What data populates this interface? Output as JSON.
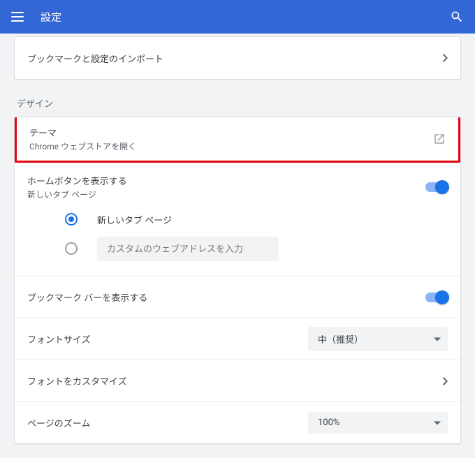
{
  "header": {
    "title": "設定"
  },
  "import": {
    "label": "ブックマークと設定のインポート"
  },
  "design": {
    "title": "デザイン",
    "theme": {
      "title": "テーマ",
      "subtitle": "Chrome ウェブストアを開く"
    },
    "home": {
      "title": "ホームボタンを表示する",
      "subtitle": "新しいタブ ページ",
      "options": {
        "newtab": "新しいタブ ページ",
        "custom_placeholder": "カスタムのウェブアドレスを入力"
      }
    },
    "bookmarksbar": "ブックマーク バーを表示する",
    "fontsize": {
      "label": "フォントサイズ",
      "value": "中（推奨）"
    },
    "fontcustom": "フォントをカスタマイズ",
    "zoom": {
      "label": "ページのズーム",
      "value": "100%"
    }
  }
}
